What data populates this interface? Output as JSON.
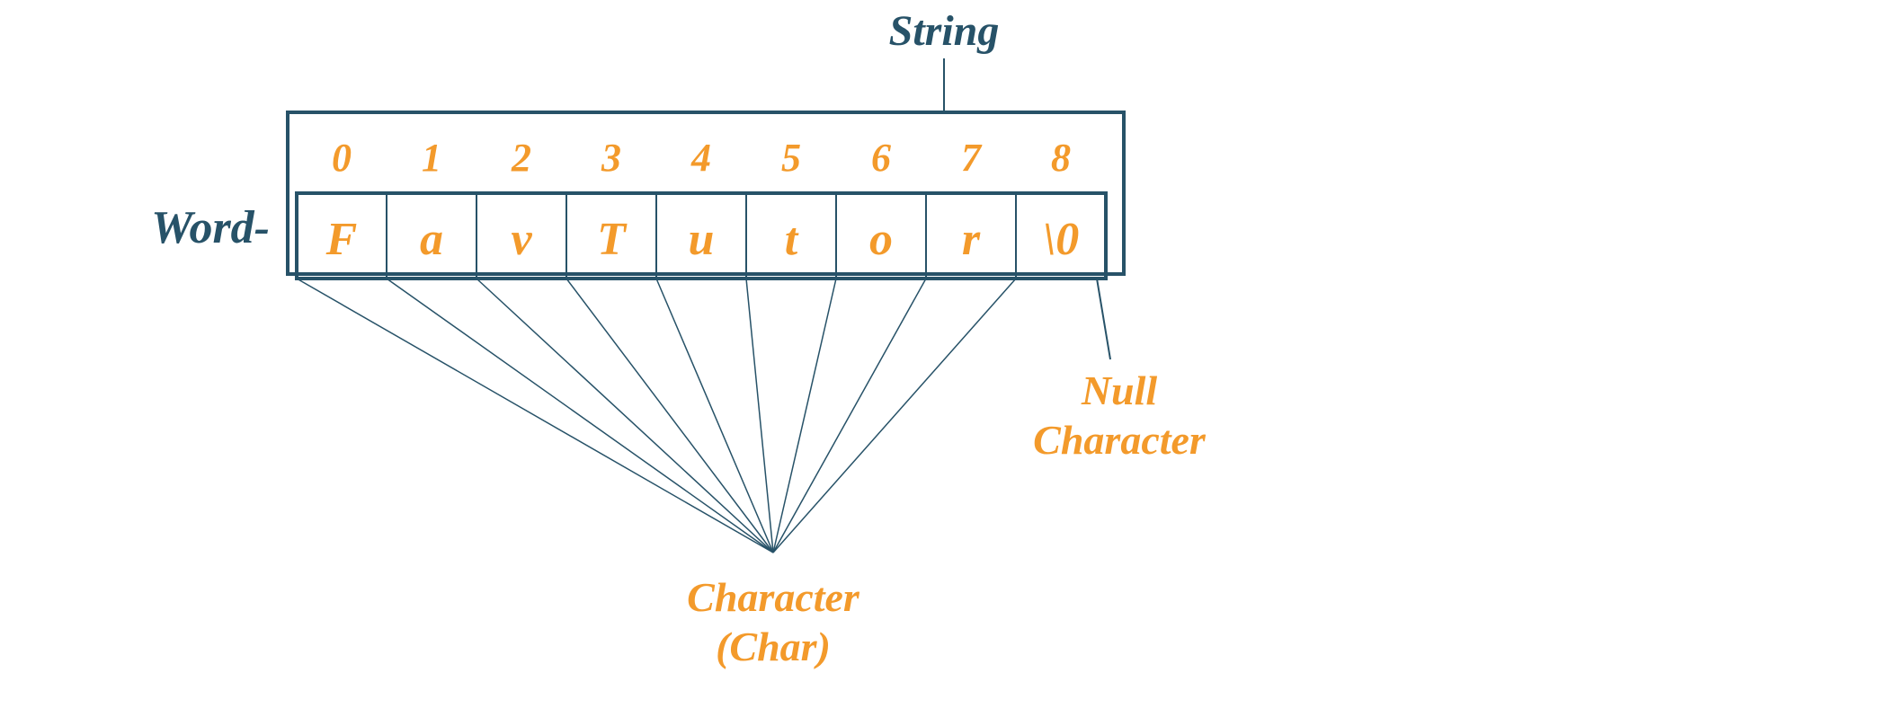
{
  "title": "String",
  "word_label": "Word-",
  "indices": [
    "0",
    "1",
    "2",
    "3",
    "4",
    "5",
    "6",
    "7",
    "8"
  ],
  "chars": [
    "F",
    "a",
    "v",
    "T",
    "u",
    "t",
    "o",
    "r",
    "\\0"
  ],
  "char_label_line1": "Character",
  "char_label_line2": "(Char)",
  "null_label_line1": "Null",
  "null_label_line2": "Character",
  "colors": {
    "dark": "#275268",
    "orange": "#f39a2b"
  }
}
